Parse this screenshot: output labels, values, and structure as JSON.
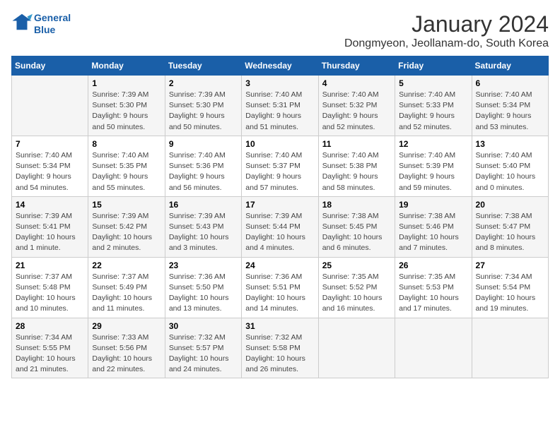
{
  "logo": {
    "line1": "General",
    "line2": "Blue"
  },
  "title": "January 2024",
  "subtitle": "Dongmyeon, Jeollanam-do, South Korea",
  "headers": [
    "Sunday",
    "Monday",
    "Tuesday",
    "Wednesday",
    "Thursday",
    "Friday",
    "Saturday"
  ],
  "weeks": [
    [
      {
        "day": "",
        "info": ""
      },
      {
        "day": "1",
        "info": "Sunrise: 7:39 AM\nSunset: 5:30 PM\nDaylight: 9 hours\nand 50 minutes."
      },
      {
        "day": "2",
        "info": "Sunrise: 7:39 AM\nSunset: 5:30 PM\nDaylight: 9 hours\nand 50 minutes."
      },
      {
        "day": "3",
        "info": "Sunrise: 7:40 AM\nSunset: 5:31 PM\nDaylight: 9 hours\nand 51 minutes."
      },
      {
        "day": "4",
        "info": "Sunrise: 7:40 AM\nSunset: 5:32 PM\nDaylight: 9 hours\nand 52 minutes."
      },
      {
        "day": "5",
        "info": "Sunrise: 7:40 AM\nSunset: 5:33 PM\nDaylight: 9 hours\nand 52 minutes."
      },
      {
        "day": "6",
        "info": "Sunrise: 7:40 AM\nSunset: 5:34 PM\nDaylight: 9 hours\nand 53 minutes."
      }
    ],
    [
      {
        "day": "7",
        "info": "Sunrise: 7:40 AM\nSunset: 5:34 PM\nDaylight: 9 hours\nand 54 minutes."
      },
      {
        "day": "8",
        "info": "Sunrise: 7:40 AM\nSunset: 5:35 PM\nDaylight: 9 hours\nand 55 minutes."
      },
      {
        "day": "9",
        "info": "Sunrise: 7:40 AM\nSunset: 5:36 PM\nDaylight: 9 hours\nand 56 minutes."
      },
      {
        "day": "10",
        "info": "Sunrise: 7:40 AM\nSunset: 5:37 PM\nDaylight: 9 hours\nand 57 minutes."
      },
      {
        "day": "11",
        "info": "Sunrise: 7:40 AM\nSunset: 5:38 PM\nDaylight: 9 hours\nand 58 minutes."
      },
      {
        "day": "12",
        "info": "Sunrise: 7:40 AM\nSunset: 5:39 PM\nDaylight: 9 hours\nand 59 minutes."
      },
      {
        "day": "13",
        "info": "Sunrise: 7:40 AM\nSunset: 5:40 PM\nDaylight: 10 hours\nand 0 minutes."
      }
    ],
    [
      {
        "day": "14",
        "info": "Sunrise: 7:39 AM\nSunset: 5:41 PM\nDaylight: 10 hours\nand 1 minute."
      },
      {
        "day": "15",
        "info": "Sunrise: 7:39 AM\nSunset: 5:42 PM\nDaylight: 10 hours\nand 2 minutes."
      },
      {
        "day": "16",
        "info": "Sunrise: 7:39 AM\nSunset: 5:43 PM\nDaylight: 10 hours\nand 3 minutes."
      },
      {
        "day": "17",
        "info": "Sunrise: 7:39 AM\nSunset: 5:44 PM\nDaylight: 10 hours\nand 4 minutes."
      },
      {
        "day": "18",
        "info": "Sunrise: 7:38 AM\nSunset: 5:45 PM\nDaylight: 10 hours\nand 6 minutes."
      },
      {
        "day": "19",
        "info": "Sunrise: 7:38 AM\nSunset: 5:46 PM\nDaylight: 10 hours\nand 7 minutes."
      },
      {
        "day": "20",
        "info": "Sunrise: 7:38 AM\nSunset: 5:47 PM\nDaylight: 10 hours\nand 8 minutes."
      }
    ],
    [
      {
        "day": "21",
        "info": "Sunrise: 7:37 AM\nSunset: 5:48 PM\nDaylight: 10 hours\nand 10 minutes."
      },
      {
        "day": "22",
        "info": "Sunrise: 7:37 AM\nSunset: 5:49 PM\nDaylight: 10 hours\nand 11 minutes."
      },
      {
        "day": "23",
        "info": "Sunrise: 7:36 AM\nSunset: 5:50 PM\nDaylight: 10 hours\nand 13 minutes."
      },
      {
        "day": "24",
        "info": "Sunrise: 7:36 AM\nSunset: 5:51 PM\nDaylight: 10 hours\nand 14 minutes."
      },
      {
        "day": "25",
        "info": "Sunrise: 7:35 AM\nSunset: 5:52 PM\nDaylight: 10 hours\nand 16 minutes."
      },
      {
        "day": "26",
        "info": "Sunrise: 7:35 AM\nSunset: 5:53 PM\nDaylight: 10 hours\nand 17 minutes."
      },
      {
        "day": "27",
        "info": "Sunrise: 7:34 AM\nSunset: 5:54 PM\nDaylight: 10 hours\nand 19 minutes."
      }
    ],
    [
      {
        "day": "28",
        "info": "Sunrise: 7:34 AM\nSunset: 5:55 PM\nDaylight: 10 hours\nand 21 minutes."
      },
      {
        "day": "29",
        "info": "Sunrise: 7:33 AM\nSunset: 5:56 PM\nDaylight: 10 hours\nand 22 minutes."
      },
      {
        "day": "30",
        "info": "Sunrise: 7:32 AM\nSunset: 5:57 PM\nDaylight: 10 hours\nand 24 minutes."
      },
      {
        "day": "31",
        "info": "Sunrise: 7:32 AM\nSunset: 5:58 PM\nDaylight: 10 hours\nand 26 minutes."
      },
      {
        "day": "",
        "info": ""
      },
      {
        "day": "",
        "info": ""
      },
      {
        "day": "",
        "info": ""
      }
    ]
  ]
}
